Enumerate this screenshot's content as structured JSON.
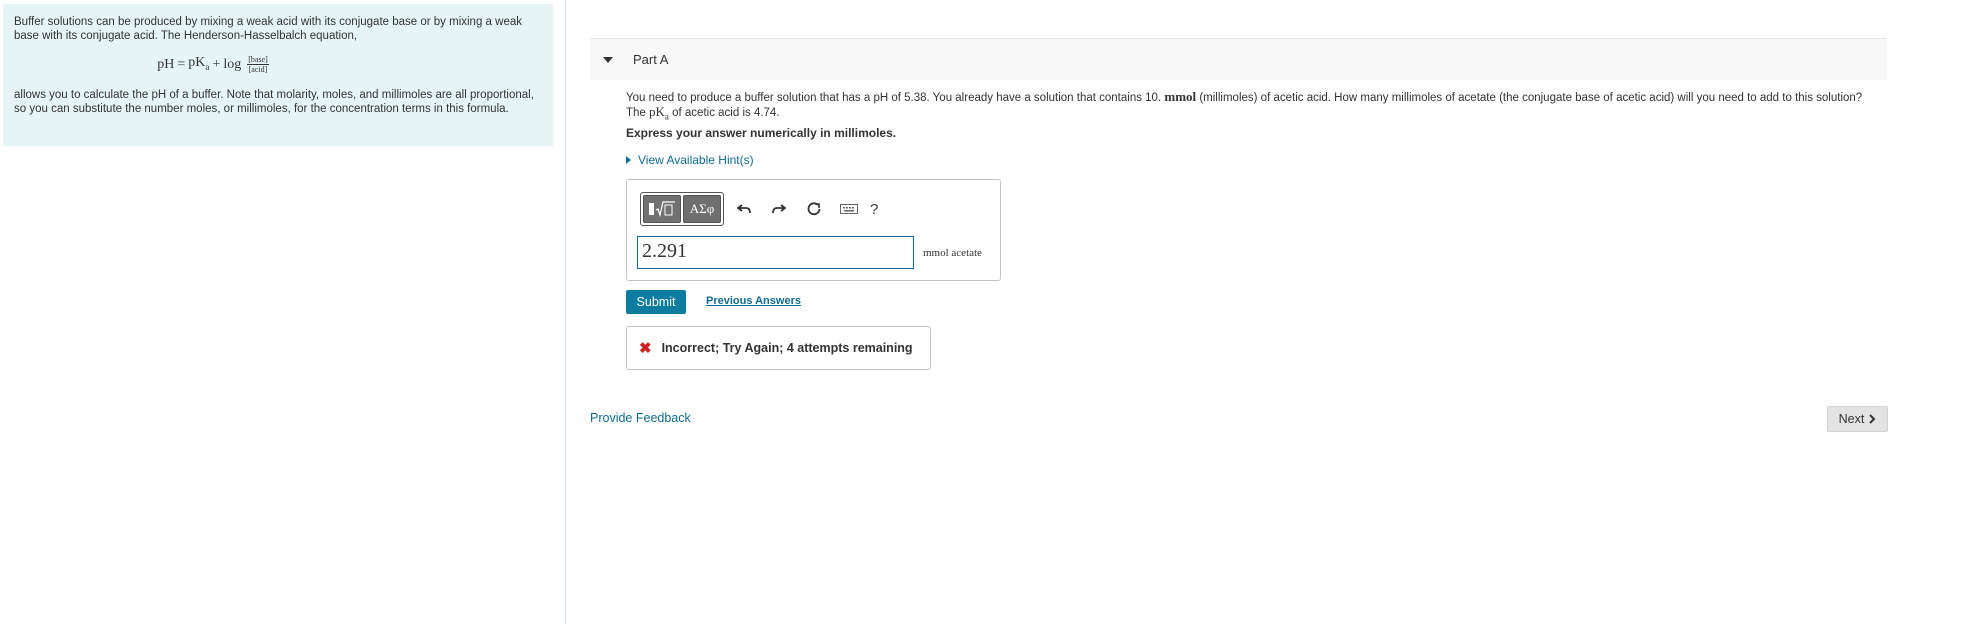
{
  "intro": {
    "paragraph1": "Buffer solutions can be produced by mixing a weak acid with its conjugate base or by mixing a weak base with its conjugate acid. The Henderson-Hasselbalch equation,",
    "equation_lhs": "pH",
    "equation_eq": "=",
    "equation_pk": "pK",
    "equation_pk_sub": "a",
    "equation_plus": "+",
    "equation_log": "log",
    "equation_num": "[base]",
    "equation_den": "[acid]",
    "paragraph2": "allows you to calculate the pH of a buffer. Note that molarity, moles, and millimoles are all proportional, so you can substitute the number moles, or millimoles, for the concentration terms in this formula."
  },
  "part": {
    "title": "Part A"
  },
  "question": {
    "text_a": "You need to produce a buffer solution that has a pH of 5.38. You already have a solution that contains 10.",
    "unit_mmol": "mmol",
    "text_b": "(millimoles) of acetic acid. How many millimoles of acetate (the conjugate base of acetic acid) will you need to add to this solution?",
    "text_c": "The",
    "pk": "pK",
    "pk_sub": "a",
    "text_d": "of acetic acid is 4.74.",
    "express": "Express your answer numerically in millimoles."
  },
  "hint": {
    "label": "View Available Hint(s)"
  },
  "toolbar": {
    "greek_label": "ΑΣφ",
    "help_label": "?"
  },
  "answer": {
    "value": "2.291",
    "unit": "mmol acetate"
  },
  "actions": {
    "submit_label": "Submit",
    "previous_answers_label": "Previous Answers"
  },
  "feedback": {
    "icon": "✖",
    "message": "Incorrect; Try Again; 4 attempts remaining"
  },
  "footer": {
    "provide_feedback_label": "Provide Feedback",
    "next_label": "Next"
  },
  "colors": {
    "accent": "#0c7ca0",
    "link": "#0c6c95",
    "intro_bg": "#e5f5f5",
    "error": "#cc2222"
  }
}
